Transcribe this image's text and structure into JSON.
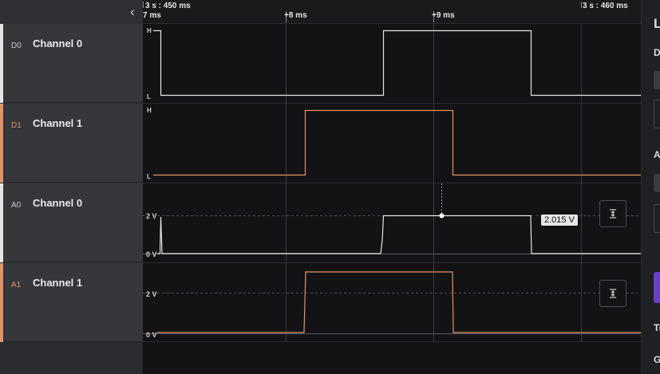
{
  "sidebar": {
    "collapse_glyph": "‹",
    "channels": [
      {
        "id": "D0",
        "name": "Channel 0",
        "color": "#e5e5e5",
        "id_color": "#c8c8c8"
      },
      {
        "id": "D1",
        "name": "Channel 1",
        "color": "#e0946a",
        "id_color": "#e0946a"
      },
      {
        "id": "A0",
        "name": "Channel 0",
        "color": "#e5e5e5",
        "id_color": "#c8c8c8"
      },
      {
        "id": "A1",
        "name": "Channel 1",
        "color": "#e0946a",
        "id_color": "#e0946a"
      }
    ]
  },
  "timeline": {
    "start_time": "3 s : 450 ms",
    "start_offset": "7 ms",
    "marker_8": "+8 ms",
    "marker_9": "+9 ms",
    "end_time": "3 s : 460 ms"
  },
  "traces": {
    "digital_high": "H",
    "digital_low": "L",
    "analog_label_high": "2 V",
    "analog_label_low": "0 V"
  },
  "measurement": {
    "value": "2.015 V"
  },
  "right_panel": {
    "heading": "L",
    "label_1": "D",
    "label_2": "A",
    "label_3": "Tr",
    "label_4": "G"
  },
  "colors": {
    "white_trace": "#e5e5e5",
    "orange_trace": "#e0946a",
    "accent": "#6c3fc9"
  }
}
